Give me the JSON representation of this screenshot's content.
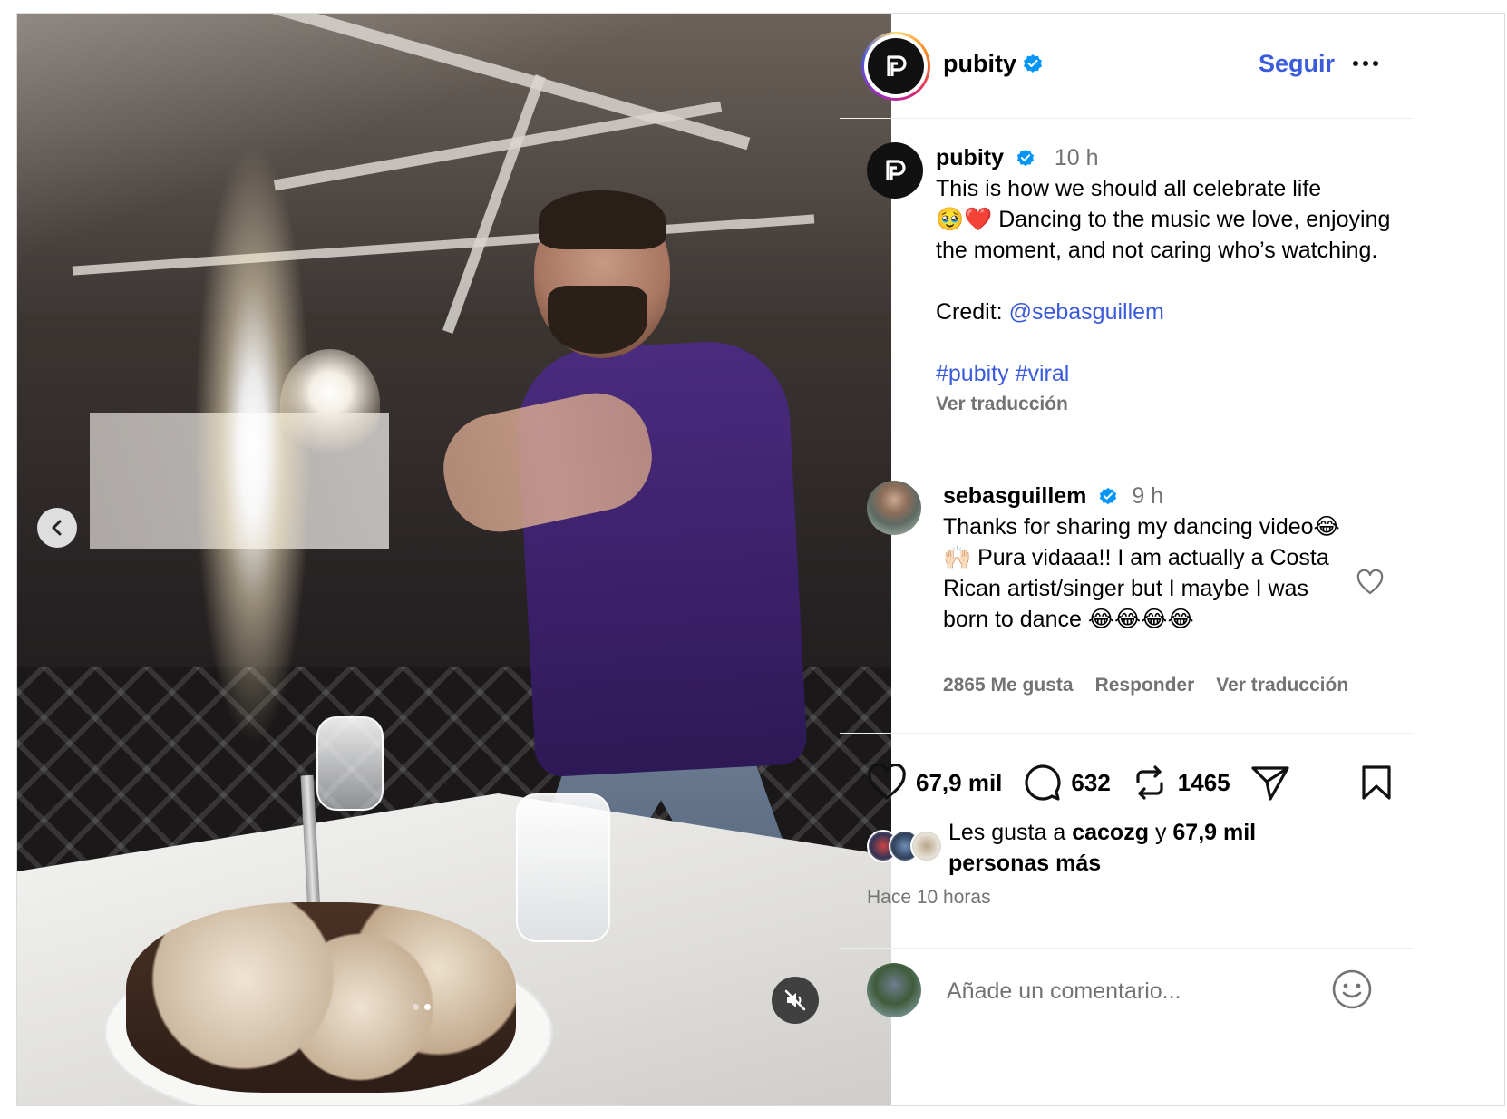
{
  "post": {
    "author": "pubity",
    "follow_label": "Seguir",
    "caption_time": "10 h",
    "caption_line1": "This is how we should all celebrate life",
    "caption_line2": "🥹❤️ Dancing to the music we love, enjoying the moment, and not caring who’s watching.",
    "credit_label": "Credit:",
    "credit_handle": "@sebasguillem",
    "tag1": "#pubity",
    "tag2": "#viral",
    "see_translation": "Ver traducción"
  },
  "comment": {
    "author": "sebasguillem",
    "time": "9 h",
    "text": "Thanks for sharing my dancing video😂🙌🏻 Pura vidaaa!! I am actually a Costa Rican artist/singer but I maybe I was born to dance 😂😂😂😂",
    "likes": "2865 Me gusta",
    "reply": "Responder",
    "translate": "Ver traducción"
  },
  "actions": {
    "likes_count": "67,9 mil",
    "comments_count": "632",
    "reposts_count": "1465"
  },
  "liked_by": {
    "prefix": "Les gusta a",
    "user": "cacozg",
    "connector": "y",
    "count": "67,9 mil",
    "suffix": "personas más"
  },
  "time_ago": "Hace 10 horas",
  "add_comment": {
    "placeholder": "Añade un comentario..."
  },
  "carousel": {
    "total": 2,
    "active": 2
  },
  "colors": {
    "link": "#3a5bdc",
    "verified": "#0095f6",
    "muted": "#737373"
  }
}
